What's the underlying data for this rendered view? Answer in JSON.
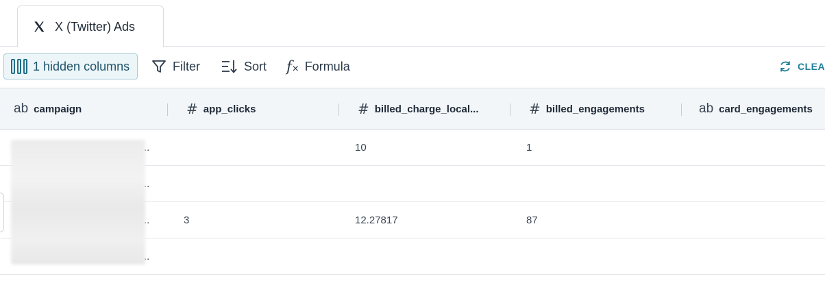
{
  "tab": {
    "label": "X (Twitter) Ads",
    "icon": "x-logo-icon"
  },
  "toolbar": {
    "hidden_columns": "1 hidden columns",
    "filter": "Filter",
    "sort": "Sort",
    "formula": "Formula",
    "clear": "CLEAR"
  },
  "columns": [
    {
      "type": "ab",
      "name": "campaign"
    },
    {
      "type": "#",
      "name": "app_clicks"
    },
    {
      "type": "#",
      "name": "billed_charge_local..."
    },
    {
      "type": "#",
      "name": "billed_engagements"
    },
    {
      "type": "ab",
      "name": "card_engagements"
    }
  ],
  "rows": [
    {
      "campaign_suffix": "..",
      "app_clicks": "",
      "billed_charge_local": "10",
      "billed_engagements": "1",
      "card_engagements": ""
    },
    {
      "campaign_suffix": "..",
      "app_clicks": "",
      "billed_charge_local": "",
      "billed_engagements": "",
      "card_engagements": ""
    },
    {
      "campaign_suffix": "..",
      "app_clicks": "3",
      "billed_charge_local": "12.27817",
      "billed_engagements": "87",
      "card_engagements": ""
    },
    {
      "campaign_suffix": "..",
      "app_clicks": "",
      "billed_charge_local": "",
      "billed_engagements": "",
      "card_engagements": ""
    }
  ],
  "colors": {
    "accent": "#1f7f98",
    "header_bg": "#f3f6f8",
    "chip_bg": "#ecf5f8"
  }
}
